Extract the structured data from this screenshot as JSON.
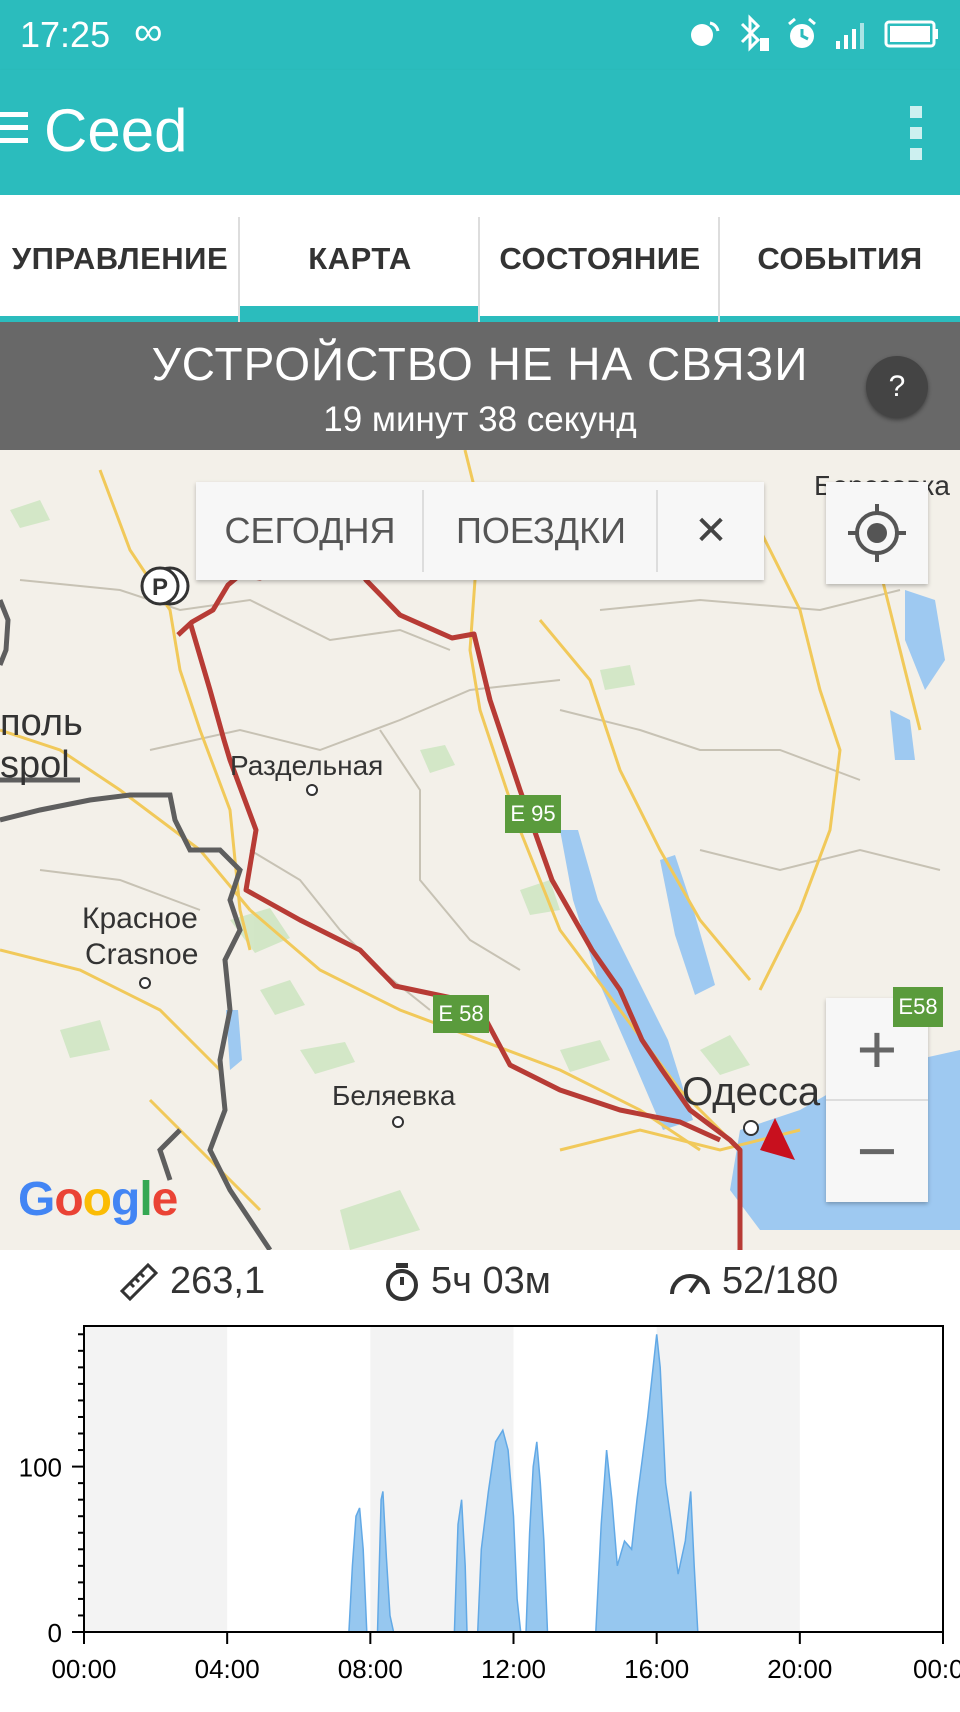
{
  "status_bar": {
    "time": "17:25",
    "infinity_icon": "infinity-icon",
    "icons": [
      "cast-icon",
      "bluetooth-icon",
      "alarm-icon",
      "signal-icon",
      "battery-icon"
    ]
  },
  "app_bar": {
    "title": "Ceed",
    "menu_icon": "hamburger-menu-icon",
    "more_icon": "more-vertical-icon",
    "color": "#2bbcbd"
  },
  "tabs": [
    {
      "label": "УПРАВЛЕНИЕ",
      "active": false
    },
    {
      "label": "КАРТА",
      "active": true
    },
    {
      "label": "СОСТОЯНИЕ",
      "active": false
    },
    {
      "label": "СОБЫТИЯ",
      "active": false
    }
  ],
  "banner": {
    "title": "УСТРОЙСТВО НЕ НА СВЯЗИ",
    "subtitle": "19 минут 38 секунд",
    "help": "?"
  },
  "map": {
    "filters": {
      "today": "СЕГОДНЯ",
      "trips": "ПОЕЗДКИ",
      "close": "✕"
    },
    "labels": {
      "berezovka": "Березовка",
      "tiraspol_ru": "поль",
      "tiraspol_en": "spol",
      "razdelnaya": "Раздельная",
      "krasnoe_ru": "Красное",
      "krasnoe_en": "Crasnoe",
      "belyaevka": "Беляевка",
      "odessa": "Одесса",
      "e95": "E 95",
      "e58": "E 58",
      "e58_side": "E58"
    },
    "zoom_in": "+",
    "zoom_out": "−",
    "attribution": "Google",
    "route_color": "#b73b35"
  },
  "stats": {
    "distance": "263,1",
    "duration": "5ч 03м",
    "speed": "52/180"
  },
  "chart_data": {
    "type": "area",
    "x_tick_labels": [
      "00:00",
      "04:00",
      "08:00",
      "12:00",
      "16:00",
      "20:00",
      "00:0"
    ],
    "y_tick_labels": [
      "0",
      "100"
    ],
    "ylim": [
      0,
      185
    ],
    "xlim_hours": [
      0,
      24
    ],
    "series": [
      {
        "color": "#90c4ee",
        "points": [
          [
            7.4,
            0
          ],
          [
            7.5,
            40
          ],
          [
            7.6,
            70
          ],
          [
            7.7,
            75
          ],
          [
            7.8,
            50
          ],
          [
            7.9,
            0
          ],
          [
            8.2,
            0
          ],
          [
            8.3,
            80
          ],
          [
            8.35,
            85
          ],
          [
            8.45,
            45
          ],
          [
            8.55,
            10
          ],
          [
            8.65,
            0
          ],
          [
            10.35,
            0
          ],
          [
            10.45,
            65
          ],
          [
            10.55,
            80
          ],
          [
            10.65,
            40
          ],
          [
            10.7,
            0
          ],
          [
            11.0,
            0
          ],
          [
            11.1,
            50
          ],
          [
            11.3,
            85
          ],
          [
            11.5,
            115
          ],
          [
            11.7,
            122
          ],
          [
            11.85,
            110
          ],
          [
            12.0,
            70
          ],
          [
            12.1,
            20
          ],
          [
            12.2,
            0
          ],
          [
            12.35,
            0
          ],
          [
            12.45,
            60
          ],
          [
            12.55,
            100
          ],
          [
            12.65,
            115
          ],
          [
            12.75,
            90
          ],
          [
            12.85,
            55
          ],
          [
            12.95,
            0
          ],
          [
            14.3,
            0
          ],
          [
            14.45,
            65
          ],
          [
            14.6,
            110
          ],
          [
            14.75,
            80
          ],
          [
            14.9,
            40
          ],
          [
            15.1,
            55
          ],
          [
            15.3,
            50
          ],
          [
            15.45,
            80
          ],
          [
            15.6,
            105
          ],
          [
            15.75,
            130
          ],
          [
            15.85,
            150
          ],
          [
            16.0,
            180
          ],
          [
            16.1,
            160
          ],
          [
            16.25,
            90
          ],
          [
            16.45,
            60
          ],
          [
            16.6,
            35
          ],
          [
            16.8,
            55
          ],
          [
            16.95,
            85
          ],
          [
            17.05,
            40
          ],
          [
            17.15,
            0
          ]
        ]
      }
    ]
  }
}
